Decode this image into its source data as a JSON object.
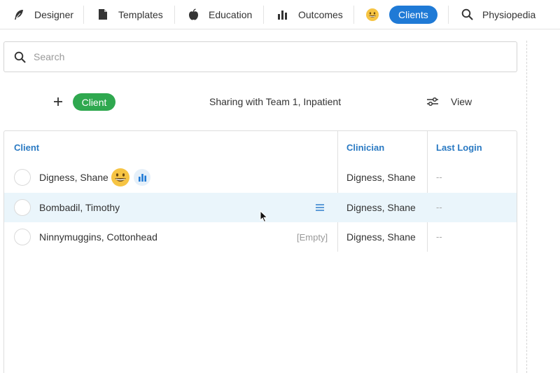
{
  "nav": {
    "items": [
      {
        "label": "Designer",
        "icon": "feather-icon"
      },
      {
        "label": "Templates",
        "icon": "document-icon"
      },
      {
        "label": "Education",
        "icon": "apple-icon"
      },
      {
        "label": "Outcomes",
        "icon": "bar-chart-icon"
      },
      {
        "label": "Clients",
        "icon": "smiley-emoji-icon",
        "active": true
      },
      {
        "label": "Physiopedia",
        "icon": "search-icon"
      }
    ],
    "active_color": "#1f7ad6"
  },
  "search": {
    "placeholder": "Search",
    "value": ""
  },
  "toolbar": {
    "client_button": "Client",
    "client_button_color": "#2fa84f",
    "sharing_text": "Sharing with Team 1, Inpatient",
    "view_label": "View"
  },
  "table": {
    "columns": [
      "Client",
      "Clinician",
      "Last Login"
    ],
    "header_color": "#2a7ac3",
    "rows": [
      {
        "client": "Digness, Shane",
        "clinician": "Digness, Shane",
        "last_login": "--",
        "badges": [
          "grinning-emoji-icon",
          "bar-chart-icon"
        ]
      },
      {
        "client": "Bombadil, Timothy",
        "clinician": "Digness, Shane",
        "last_login": "--",
        "highlighted": true,
        "menu_icon": "hamburger-menu-icon"
      },
      {
        "client": "Ninnymuggins, Cottonhead",
        "clinician": "Digness, Shane",
        "last_login": "--",
        "tag": "[Empty]"
      }
    ],
    "highlight_color": "#eaf5fb"
  }
}
